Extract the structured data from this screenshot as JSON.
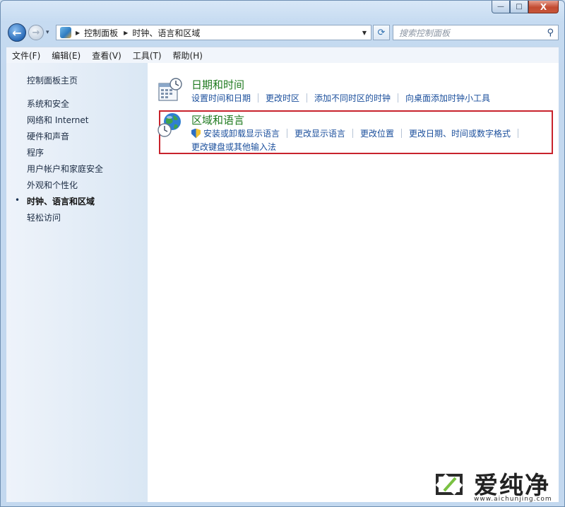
{
  "window": {
    "caption_buttons": {
      "minimize": "—",
      "maximize": "□",
      "close": "X"
    }
  },
  "navbar": {
    "back_glyph": "←",
    "forward_glyph": "→",
    "recent_glyph": "▾",
    "breadcrumb": [
      "控制面板",
      "时钟、语言和区域"
    ],
    "crumb_separator": "▶",
    "dropdown_glyph": "▼",
    "refresh_glyph": "⟳",
    "search_placeholder": "搜索控制面板",
    "search_glyph": "⚲"
  },
  "menubar": {
    "items": [
      "文件(F)",
      "编辑(E)",
      "查看(V)",
      "工具(T)",
      "帮助(H)"
    ]
  },
  "sidebar": {
    "home": "控制面板主页",
    "items": [
      {
        "label": "系统和安全",
        "active": false
      },
      {
        "label": "网络和 Internet",
        "active": false
      },
      {
        "label": "硬件和声音",
        "active": false
      },
      {
        "label": "程序",
        "active": false
      },
      {
        "label": "用户帐户和家庭安全",
        "active": false
      },
      {
        "label": "外观和个性化",
        "active": false
      },
      {
        "label": "时钟、语言和区域",
        "active": true
      },
      {
        "label": "轻松访问",
        "active": false
      }
    ],
    "active_bullet": "•"
  },
  "main": {
    "categories": [
      {
        "title": "日期和时间",
        "icon": "calendar-clock-icon",
        "links": [
          "设置时间和日期",
          "更改时区",
          "添加不同时区的时钟",
          "向桌面添加时钟小工具"
        ]
      },
      {
        "title": "区域和语言",
        "icon": "globe-clock-icon",
        "links": [
          "安装或卸载显示语言",
          "更改显示语言",
          "更改位置",
          "更改日期、时间或数字格式"
        ],
        "links_row2": [
          "更改键盘或其他输入法"
        ],
        "highlighted": true
      }
    ]
  },
  "watermark": {
    "text": "爱纯净",
    "url": "www.aichunjing.com"
  },
  "colors": {
    "highlight_border": "#c8232c",
    "category_title": "#1f7a1f",
    "link": "#1b4f9c"
  }
}
